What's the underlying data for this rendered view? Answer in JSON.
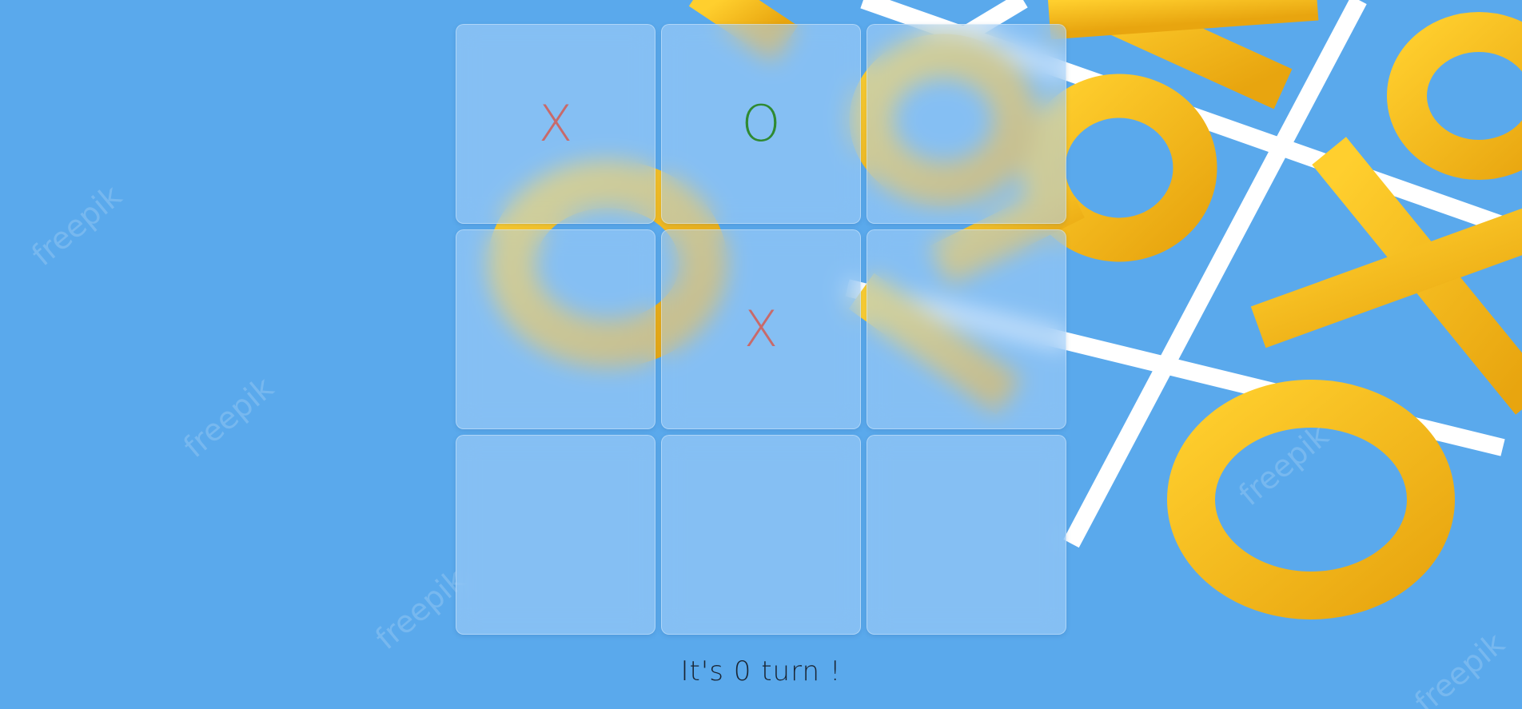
{
  "background": {
    "base_color": "#5aa9ec",
    "line_color": "#ffffff",
    "piece_color": "#f4b71c",
    "watermark": "freepik"
  },
  "board": {
    "cells": [
      {
        "value": "X",
        "symbol": "x"
      },
      {
        "value": "O",
        "symbol": "o"
      },
      {
        "value": "",
        "symbol": ""
      },
      {
        "value": "",
        "symbol": ""
      },
      {
        "value": "X",
        "symbol": "x"
      },
      {
        "value": "",
        "symbol": ""
      },
      {
        "value": "",
        "symbol": ""
      },
      {
        "value": "",
        "symbol": ""
      },
      {
        "value": "",
        "symbol": ""
      }
    ],
    "x_color": "#c86a6a",
    "o_color": "#2f8a32"
  },
  "status": {
    "text": "It's 0 turn !"
  }
}
